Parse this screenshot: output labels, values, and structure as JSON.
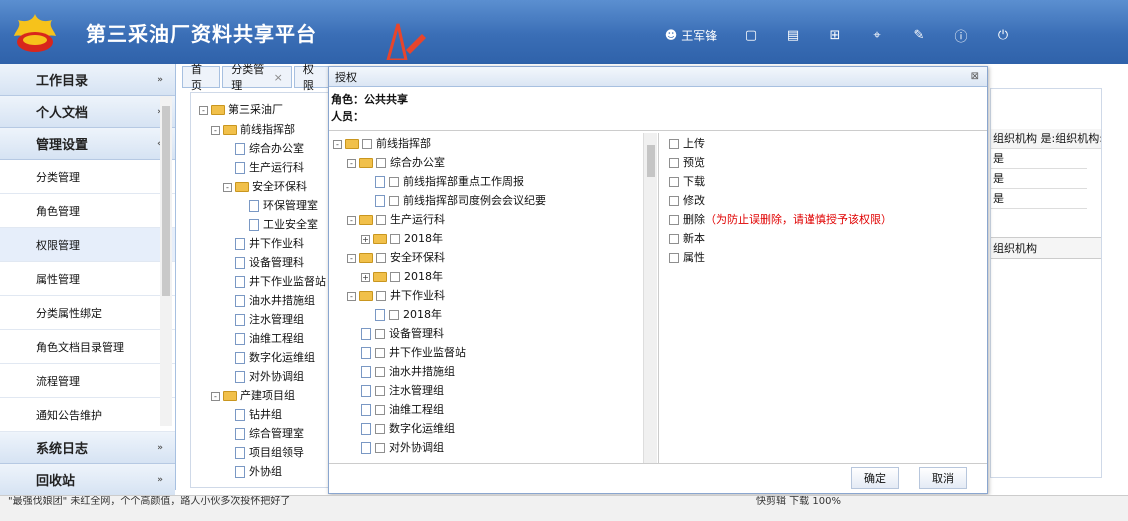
{
  "header": {
    "title": "第三采油厂资料共享平台",
    "user_name": "王军锋"
  },
  "sidebar": {
    "work_dir": "工作目录",
    "personal_docs": "个人文档",
    "management": "管理设置",
    "items": [
      "分类管理",
      "角色管理",
      "权限管理",
      "属性管理",
      "分类属性绑定",
      "角色文档目录管理",
      "流程管理",
      "通知公告维护"
    ],
    "system_log": "系统日志",
    "recycle": "回收站"
  },
  "tabs": [
    {
      "label": "首页"
    },
    {
      "label": "分类管理"
    },
    {
      "label": "权限"
    }
  ],
  "bg_tree": [
    "第三采油厂",
    "前线指挥部",
    "综合办公室",
    "生产运行科",
    "安全环保科",
    "环保管理室",
    "工业安全室",
    "井下作业科",
    "设备管理科",
    "井下作业监督站",
    "油水井措施组",
    "注水管理组",
    "油维工程组",
    "数字化运维组",
    "对外协调组",
    "产建项目组",
    "钻井组",
    "综合管理室",
    "项目组领导",
    "外协组"
  ],
  "bg_right": {
    "header": "组织机构 是:组织机构:",
    "rows": [
      "是",
      "是",
      "是"
    ],
    "header2": "组织机构"
  },
  "modal": {
    "title": "授权",
    "role": "角色：公共共享",
    "person": "人员：",
    "tree": [
      "前线指挥部",
      "综合办公室",
      "前线指挥部重点工作周报",
      "前线指挥部司度例会会议纪要",
      "生产运行科",
      "2018年",
      "安全环保科",
      "2018年",
      "井下作业科",
      "2018年",
      "设备管理科",
      "井下作业监督站",
      "油水井措施组",
      "注水管理组",
      "油维工程组",
      "数字化运维组",
      "对外协调组"
    ],
    "perms": [
      "上传",
      "预览",
      "下载",
      "修改",
      "删除",
      "新本",
      "属性"
    ],
    "delete_warning": "（为防止误删除，请谨慎授予该权限）",
    "ok": "确定",
    "cancel": "取消"
  },
  "status": {
    "left": "\"最强伐娘团\" 未红全网，个个高颜值，路人小伙多次投怀把好了",
    "right": "快剪辑  下载  100%"
  }
}
